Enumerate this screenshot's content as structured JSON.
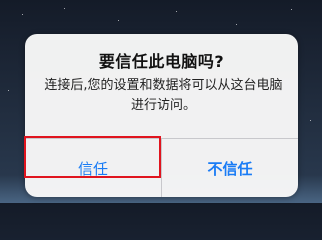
{
  "alert": {
    "title": "要信任此电脑吗?",
    "message": "连接后,您的设置和数据将可以从这台电脑进行访问。",
    "buttons": {
      "trust_label": "信任",
      "distrust_label": "不信任"
    }
  },
  "colors": {
    "button_text": "#1a7cf5",
    "highlight": "#e0141e",
    "alert_background": "#f8f8f8"
  }
}
